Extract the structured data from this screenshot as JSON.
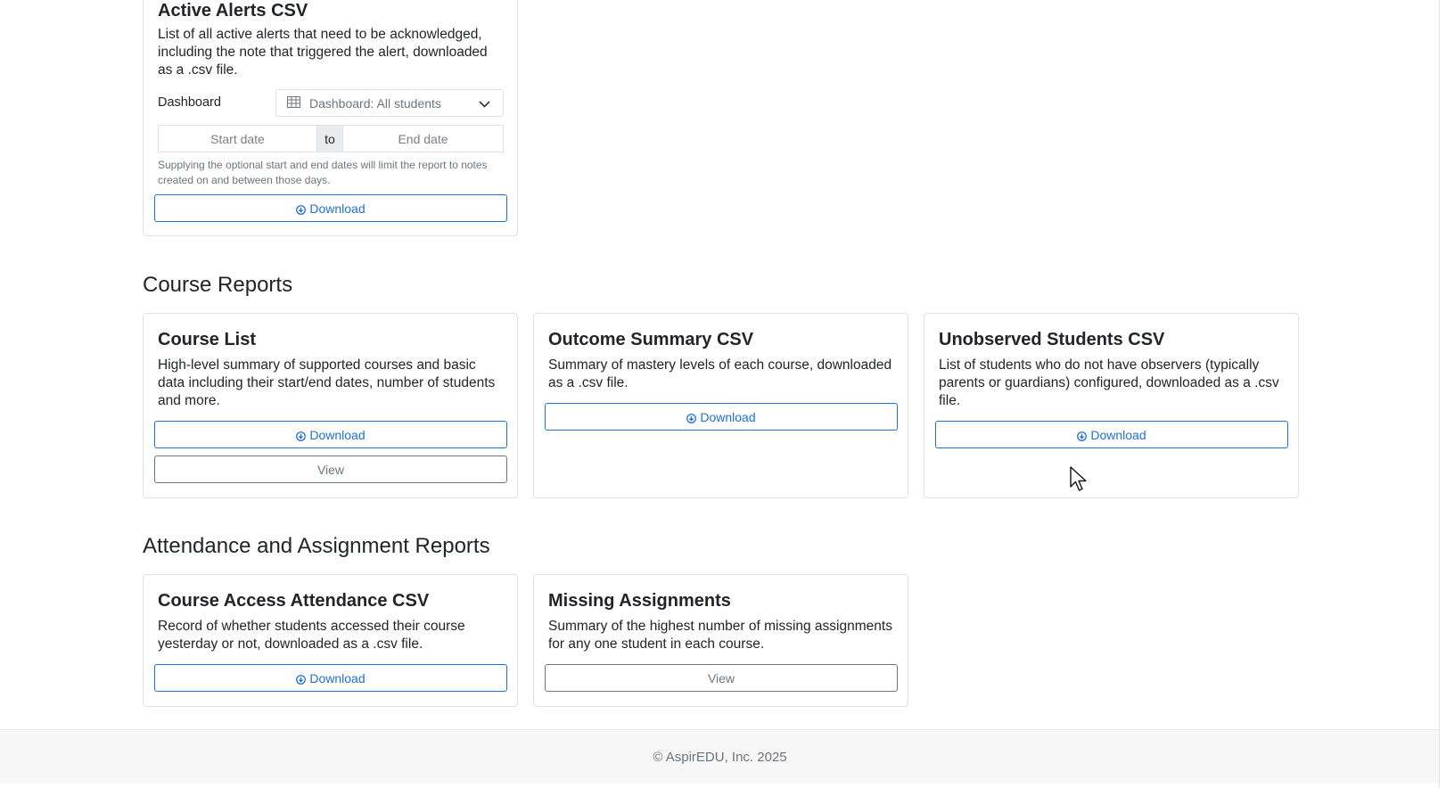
{
  "alerts_card": {
    "title": "Active Alerts CSV",
    "description": "List of all active alerts that need to be acknowledged, including the note that triggered the alert, downloaded as a .csv file.",
    "dashboard_label": "Dashboard",
    "dashboard_selected": "Dashboard: All students",
    "start_placeholder": "Start date",
    "to_label": "to",
    "end_placeholder": "End date",
    "help_text": "Supplying the optional start and end dates will limit the report to notes created on and between those days.",
    "download_label": "Download"
  },
  "course_reports": {
    "heading": "Course Reports",
    "cards": [
      {
        "title": "Course List",
        "description": "High-level summary of supported courses and basic data including their start/end dates, number of students and more.",
        "download_label": "Download",
        "view_label": "View"
      },
      {
        "title": "Outcome Summary CSV",
        "description": "Summary of mastery levels of each course, downloaded as a .csv file.",
        "download_label": "Download"
      },
      {
        "title": "Unobserved Students CSV",
        "description": "List of students who do not have observers (typically parents or guardians) configured, downloaded as a .csv file.",
        "download_label": "Download"
      }
    ]
  },
  "attendance_reports": {
    "heading": "Attendance and Assignment Reports",
    "cards": [
      {
        "title": "Course Access Attendance CSV",
        "description": "Record of whether students accessed their course yesterday or not, downloaded as a .csv file.",
        "download_label": "Download"
      },
      {
        "title": "Missing Assignments",
        "description": "Summary of the highest number of missing assignments for any one student in each course.",
        "view_label": "View"
      }
    ]
  },
  "footer": {
    "text": "© AspirEDU, Inc. 2025"
  },
  "colors": {
    "primary": "#1f6fd6",
    "secondary": "#6c757d",
    "border": "#dfe1e3"
  },
  "icons": {
    "download": "arrow-down-circle-icon",
    "table": "table-icon",
    "chevron": "chevron-down-icon"
  }
}
